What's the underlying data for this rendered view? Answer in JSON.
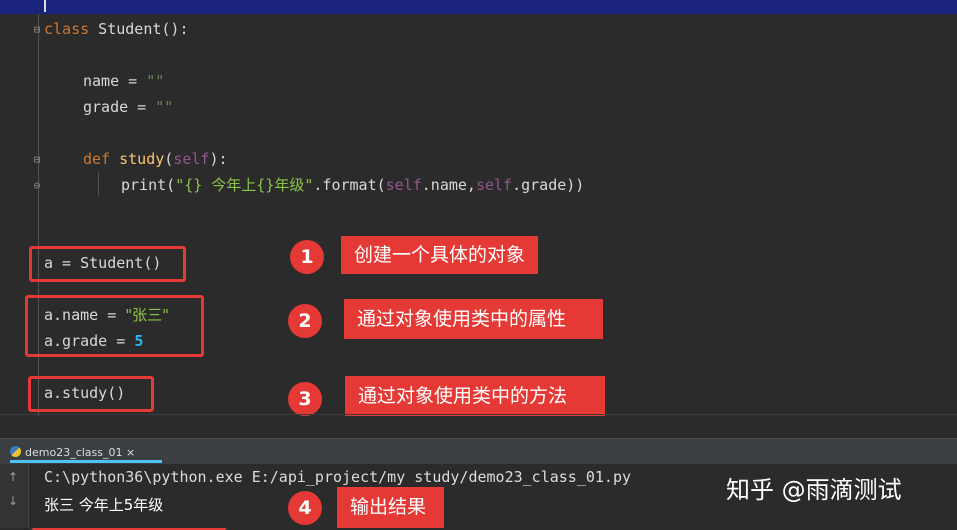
{
  "editor": {
    "lines": {
      "class_kw": "class",
      "class_name": " Student():",
      "name_assign": "name = ",
      "name_value": "\"\"",
      "grade_assign": "grade = ",
      "grade_value": "\"\"",
      "def_kw": "def",
      "method_name": " study",
      "method_paren_open": "(",
      "method_self": "self",
      "method_paren_close": "):",
      "print_call": "print(",
      "print_string": "\"{} 今年上{}年级\"",
      "format_call": ".format(",
      "format_self1": "self",
      "format_name": ".name,",
      "format_self2": "self",
      "format_grade": ".grade))",
      "instance_line": "a = Student()",
      "attr_name_line": "a.name = ",
      "attr_name_value": "\"张三\"",
      "attr_grade_line": "a.grade = ",
      "attr_grade_value": "5",
      "study_call": "a.study()"
    }
  },
  "annotations": [
    {
      "number": "1",
      "text": "创建一个具体的对象"
    },
    {
      "number": "2",
      "text": "通过对象使用类中的属性"
    },
    {
      "number": "3",
      "text": "通过对象使用类中的方法"
    },
    {
      "number": "4",
      "text": "输出结果"
    }
  ],
  "run_panel": {
    "tab_label": "demo23_class_01 ×",
    "command": "C:\\python36\\python.exe E:/api_project/my study/demo23_class_01.py",
    "output": "张三 今年上5年级",
    "up_arrow": "↑",
    "down_arrow": "↓"
  },
  "watermark": "知乎 @雨滴测试",
  "colors": {
    "accent_red": "#e53935",
    "keyword": "#cc7832",
    "function": "#ffc66d",
    "self": "#94558d",
    "string": "#6a8759",
    "number": "#29b6f6"
  }
}
